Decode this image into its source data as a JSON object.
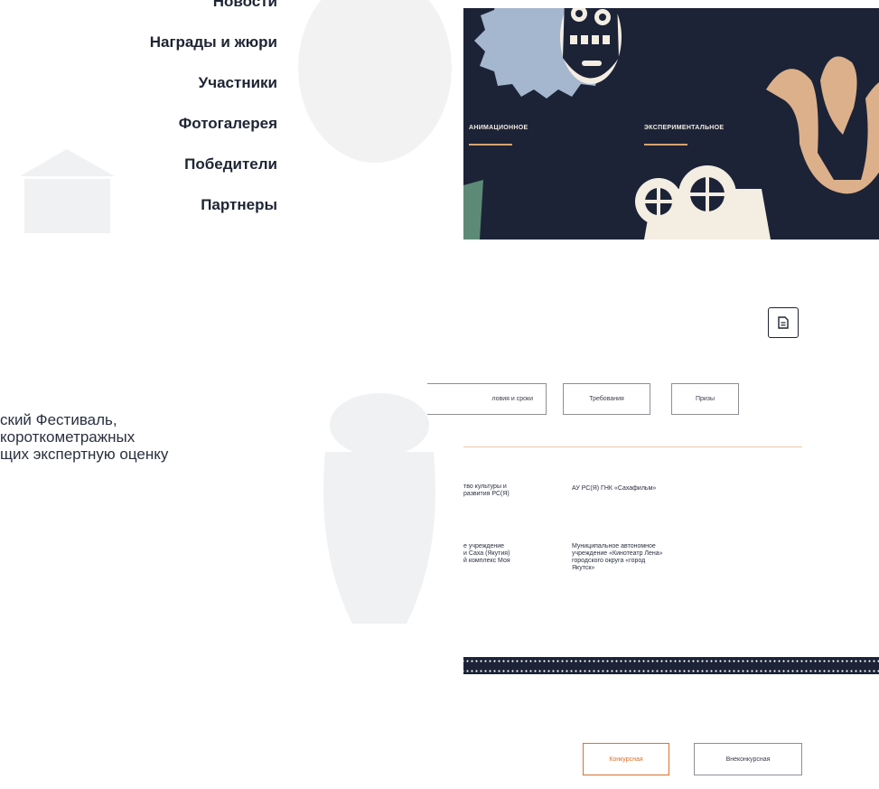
{
  "menu": {
    "items": [
      {
        "label": "Новости"
      },
      {
        "label": "Награды и жюри"
      },
      {
        "label": "Участники"
      },
      {
        "label": "Фотогалерея"
      },
      {
        "label": "Победители"
      },
      {
        "label": "Партнеры"
      }
    ]
  },
  "about": {
    "line1": "ский Фестиваль,",
    "line2": " короткометражных",
    "line3": "щих экспертную оценку"
  },
  "banner": {
    "categories": [
      {
        "label": "АНИМАЦИОННОЕ"
      },
      {
        "label": "ЭКСПЕРИМЕНТАЛЬНОЕ"
      }
    ]
  },
  "tabs": [
    {
      "label": "ловия и сроки"
    },
    {
      "label": "Требования"
    },
    {
      "label": "Призы"
    }
  ],
  "organizers": [
    {
      "text": "тво культуры и\nразвития РС(Я)"
    },
    {
      "text": "АУ РС(Я) ГНК «Сахафильм»"
    },
    {
      "text": "е учреждение\nи Саха (Якутия)\nй комплекс Моя"
    },
    {
      "text": "Муниципальное автономное\nучреждение «Кинотеатр Лена»\nгородского округа «город\nЯкутск»"
    }
  ],
  "program": {
    "competitive": "Конкурсная",
    "noncompetitive": "Внеконкурсная"
  },
  "colors": {
    "navy": "#1c2337",
    "accent": "#d9712b",
    "sand": "#d9a36f"
  },
  "icons": {
    "document": "document-icon"
  }
}
